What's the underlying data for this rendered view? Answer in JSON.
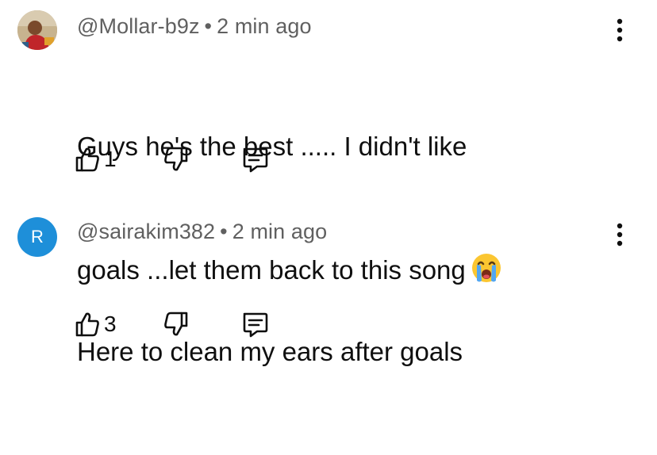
{
  "comments": [
    {
      "avatar_letter": "",
      "username": "@Mollar-b9z",
      "separator": "•",
      "time": "2 min ago",
      "text_line1": "Guys he's the best ..... I didn't like",
      "text_line2": "goals ...let them back to this song",
      "emoji_icon": "loudly-crying-face-icon",
      "like_count": "1"
    },
    {
      "avatar_letter": "R",
      "username": "@sairakim382",
      "separator": "•",
      "time": "2 min ago",
      "text_line1": "Here to clean my ears after goals",
      "like_count": "3"
    }
  ],
  "icons": {
    "like": "thumbs-up-icon",
    "dislike": "thumbs-down-icon",
    "reply": "reply-comment-icon",
    "menu": "more-vertical-icon"
  },
  "colors": {
    "text": "#0f0f0f",
    "meta": "#606060",
    "avatar_r_bg": "#1e8fd9"
  }
}
